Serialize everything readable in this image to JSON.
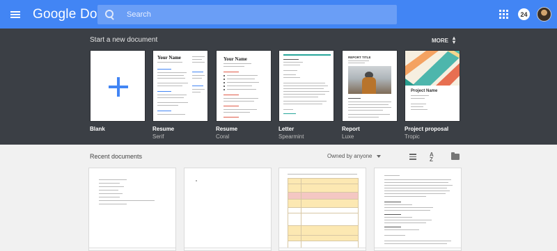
{
  "header": {
    "app_title": "Google Docs",
    "search_placeholder": "Search",
    "notification_count": "24"
  },
  "templates": {
    "section_title": "Start a new document",
    "more_label": "MORE",
    "items": [
      {
        "name": "Blank",
        "sub": ""
      },
      {
        "name": "Resume",
        "sub": "Serif",
        "thumb_title": "Your Name"
      },
      {
        "name": "Resume",
        "sub": "Coral",
        "thumb_title": "Your Name"
      },
      {
        "name": "Letter",
        "sub": "Spearmint"
      },
      {
        "name": "Report",
        "sub": "Luxe",
        "thumb_title": "REPORT TITLE"
      },
      {
        "name": "Project proposal",
        "sub": "Tropic",
        "thumb_title": "Project Name"
      }
    ]
  },
  "recent": {
    "section_title": "Recent documents",
    "owner_filter": "Owned by anyone"
  },
  "colors": {
    "header_blue": "#4285f4",
    "template_bg": "#3b3f45",
    "page_bg": "#f1f1f1",
    "coral_accent": "#e05a47",
    "spearmint_accent": "#26a69a",
    "tropic_accent": "#4db6ac"
  },
  "icons": [
    "hamburger-menu-icon",
    "search-icon",
    "apps-grid-icon",
    "chevron-up-down-icon",
    "plus-icon",
    "list-view-icon",
    "sort-az-icon",
    "folder-icon"
  ]
}
